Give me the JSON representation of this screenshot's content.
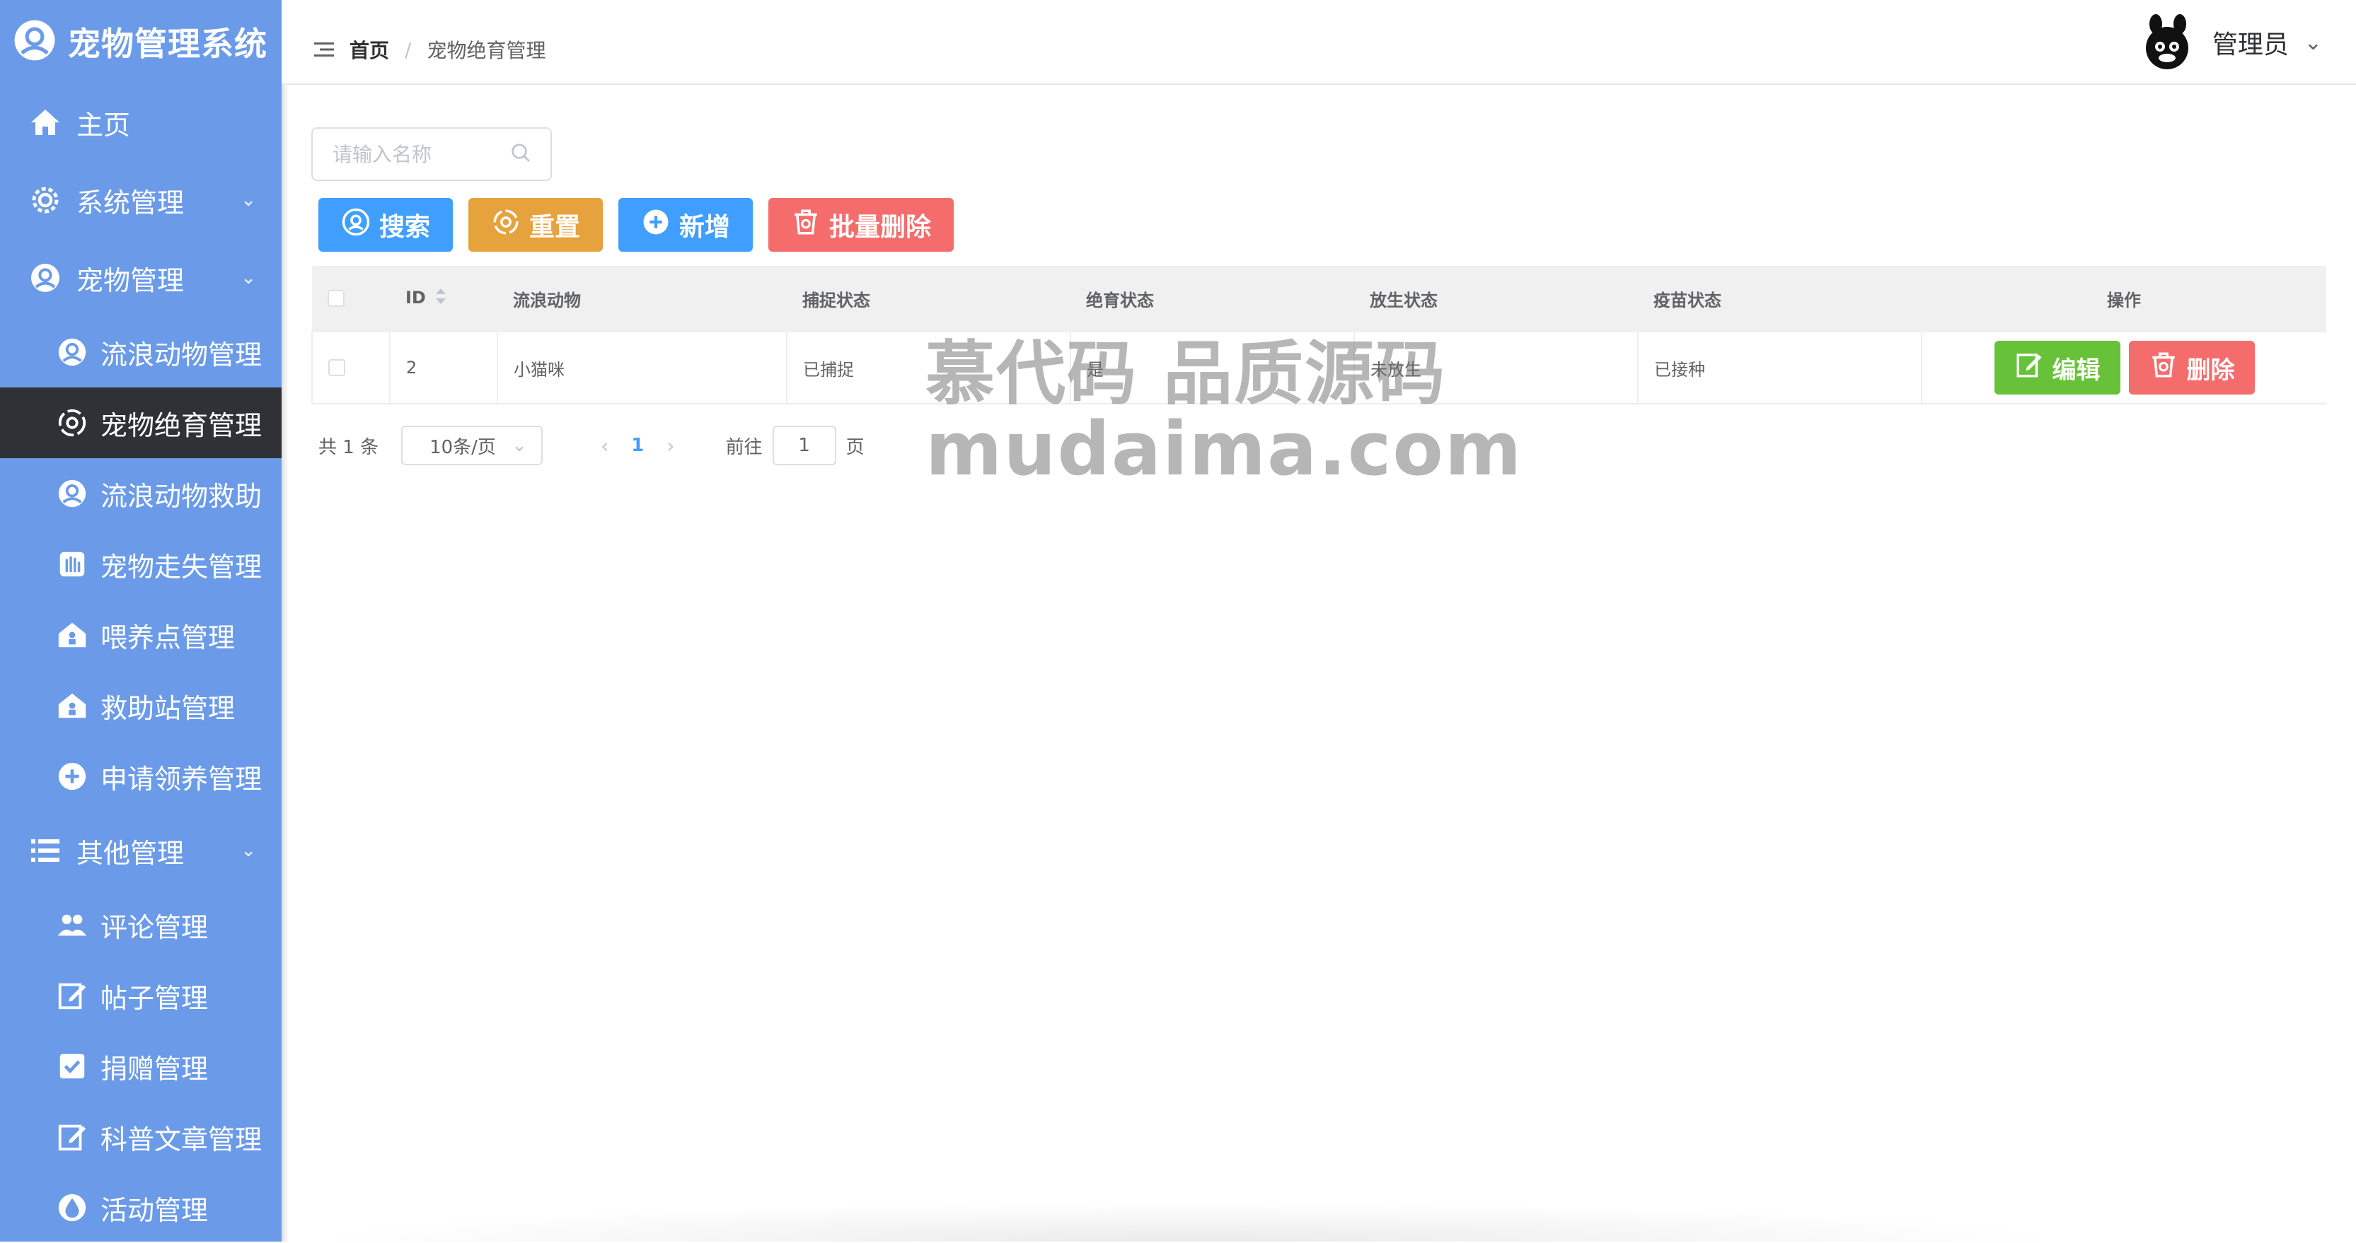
{
  "app": {
    "title": "宠物管理系统"
  },
  "sidebar": {
    "items": [
      {
        "label": "主页",
        "icon": "home-icon",
        "level": "top"
      },
      {
        "label": "系统管理",
        "icon": "gear-icon",
        "level": "top",
        "expandable": true
      },
      {
        "label": "宠物管理",
        "icon": "pet-icon",
        "level": "top",
        "expandable": true
      },
      {
        "label": "流浪动物管理",
        "icon": "pet-icon",
        "level": "sub"
      },
      {
        "label": "宠物绝育管理",
        "icon": "eye-icon",
        "level": "sub",
        "active": true
      },
      {
        "label": "流浪动物救助",
        "icon": "pet-icon",
        "level": "sub"
      },
      {
        "label": "宠物走失管理",
        "icon": "hand-icon",
        "level": "sub"
      },
      {
        "label": "喂养点管理",
        "icon": "house-icon",
        "level": "sub"
      },
      {
        "label": "救助站管理",
        "icon": "house-icon",
        "level": "sub"
      },
      {
        "label": "申请领养管理",
        "icon": "plus-circle-icon",
        "level": "sub"
      },
      {
        "label": "其他管理",
        "icon": "list-icon",
        "level": "top",
        "expandable": true
      },
      {
        "label": "评论管理",
        "icon": "users-icon",
        "level": "sub"
      },
      {
        "label": "帖子管理",
        "icon": "edit-icon",
        "level": "sub"
      },
      {
        "label": "捐赠管理",
        "icon": "check-square-icon",
        "level": "sub"
      },
      {
        "label": "科普文章管理",
        "icon": "edit-icon",
        "level": "sub"
      },
      {
        "label": "活动管理",
        "icon": "drop-icon",
        "level": "sub"
      }
    ]
  },
  "header": {
    "breadcrumb": {
      "home": "首页",
      "separator": "/",
      "current": "宠物绝育管理"
    },
    "user": {
      "name": "管理员"
    }
  },
  "search": {
    "placeholder": "请输入名称",
    "value": ""
  },
  "toolbar": {
    "search_label": "搜索",
    "reset_label": "重置",
    "add_label": "新增",
    "batch_delete_label": "批量删除"
  },
  "table": {
    "columns": [
      "ID",
      "流浪动物",
      "捕捉状态",
      "绝育状态",
      "放生状态",
      "疫苗状态",
      "操作"
    ],
    "rows": [
      {
        "id": "2",
        "animal": "小猫咪",
        "capture": "已捕捉",
        "sterilize": "是",
        "release": "未放生",
        "vaccine": "已接种",
        "edit_label": "编辑",
        "delete_label": "删除"
      }
    ]
  },
  "pagination": {
    "total_text": "共 1 条",
    "page_size": "10条/页",
    "current_page": "1",
    "goto_prefix": "前往",
    "goto_value": "1",
    "goto_suffix": "页"
  },
  "watermark": {
    "line1": "慕代码 品质源码",
    "line2": "mudaima.com"
  },
  "colors": {
    "sidebar": "#6b9be8",
    "active": "#2f3136",
    "primary": "#409eff",
    "warning": "#e6a23c",
    "danger": "#f56c6c",
    "success": "#67c23a"
  }
}
